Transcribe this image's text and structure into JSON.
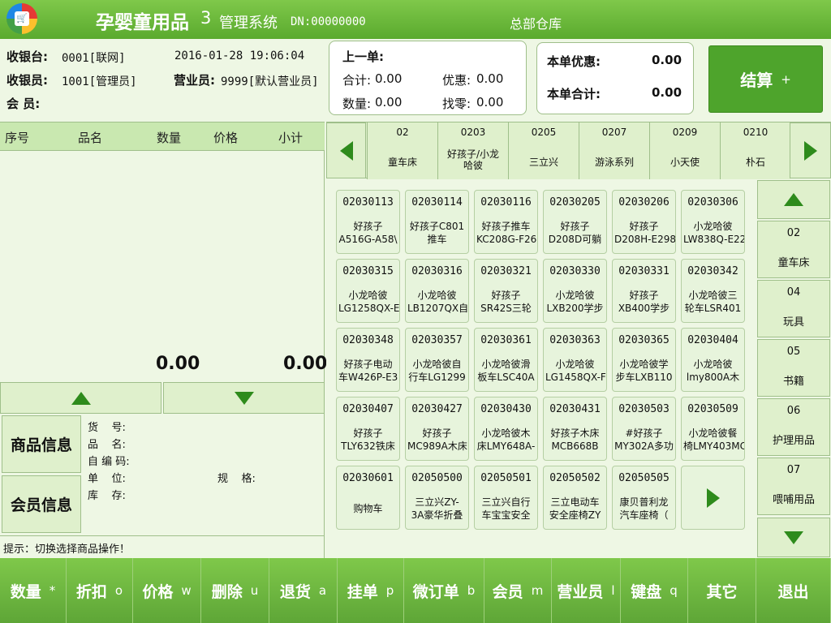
{
  "header": {
    "title": "孕婴童用品",
    "version": "3",
    "subtitle": "管理系统",
    "dn": "DN:00000000",
    "warehouse": "总部仓库"
  },
  "info": {
    "cashier_label": "收银台:",
    "cashier_value": "0001[联网]",
    "datetime": "2016-01-28 19:06:04",
    "operator_label": "收银员:",
    "operator_value": "1001[管理员]",
    "sales_label": "营业员:",
    "sales_value": "9999[默认营业员]",
    "member_label": "会  员:"
  },
  "last_order": {
    "title": "上一单:",
    "total_label": "合计:",
    "total": "0.00",
    "discount_label": "优惠:",
    "discount": "0.00",
    "qty_label": "数量:",
    "qty": "0.00",
    "change_label": "找零:",
    "change": "0.00"
  },
  "current": {
    "discount_label": "本单优惠:",
    "discount": "0.00",
    "total_label": "本单合计:",
    "total": "0.00"
  },
  "settle": {
    "label": "结算",
    "key": "+"
  },
  "list": {
    "headers": [
      "序号",
      "品名",
      "数量",
      "价格",
      "小计"
    ],
    "qty_total": "0.00",
    "sum_total": "0.00"
  },
  "info_panel": {
    "goods_tab": "商品信息",
    "member_tab": "会员信息",
    "fields": {
      "sku": "货    号:",
      "name": "品    名:",
      "code": "自 编 码:",
      "unit": "单    位:",
      "spec": "规    格:",
      "stock": "库    存:"
    }
  },
  "hint": "提示：切换选择商品操作！",
  "categories": [
    {
      "code": "02",
      "name": "童车床"
    },
    {
      "code": "0203",
      "name": "好孩子/小龙\n哈彼"
    },
    {
      "code": "0205",
      "name": "三立兴"
    },
    {
      "code": "0207",
      "name": "游泳系列"
    },
    {
      "code": "0209",
      "name": "小天使"
    },
    {
      "code": "0210",
      "name": "朴石"
    }
  ],
  "products": [
    {
      "code": "02030113",
      "name": "好孩子\nA516G-A58\\"
    },
    {
      "code": "02030114",
      "name": "好孩子C801\n推车"
    },
    {
      "code": "02030116",
      "name": "好孩子推车\nKC208G-F26"
    },
    {
      "code": "02030205",
      "name": "好孩子\nD208D可躺"
    },
    {
      "code": "02030206",
      "name": "好孩子\nD208H-E298"
    },
    {
      "code": "02030306",
      "name": "小龙哈彼\nLW838Q-E22"
    },
    {
      "code": "02030315",
      "name": "小龙哈彼\nLG1258QX-E"
    },
    {
      "code": "02030316",
      "name": "小龙哈彼\nLB1207QX自"
    },
    {
      "code": "02030321",
      "name": "好孩子\nSR42S三轮"
    },
    {
      "code": "02030330",
      "name": "小龙哈彼\nLXB200学步"
    },
    {
      "code": "02030331",
      "name": "好孩子\nXB400学步"
    },
    {
      "code": "02030342",
      "name": "小龙哈彼三\n轮车LSR401"
    },
    {
      "code": "02030348",
      "name": "好孩子电动\n车W426P-E3"
    },
    {
      "code": "02030357",
      "name": "小龙哈彼自\n行车LG1299"
    },
    {
      "code": "02030361",
      "name": "小龙哈彼滑\n板车LSC40A"
    },
    {
      "code": "02030363",
      "name": "小龙哈彼\nLG1458QX-F"
    },
    {
      "code": "02030365",
      "name": "小龙哈彼学\n步车LXB110"
    },
    {
      "code": "02030404",
      "name": "小龙哈彼\nlmy800A木"
    },
    {
      "code": "02030407",
      "name": "好孩子\nTLY632铁床"
    },
    {
      "code": "02030427",
      "name": "好孩子\nMC989A木床"
    },
    {
      "code": "02030430",
      "name": "小龙哈彼木\n床LMY648A-"
    },
    {
      "code": "02030431",
      "name": "好孩子木床\nMCB668B"
    },
    {
      "code": "02030503",
      "name": "#好孩子\nMY302A多功"
    },
    {
      "code": "02030509",
      "name": "小龙哈彼餐\n椅LMY403MC"
    },
    {
      "code": "02030601",
      "name": "购物车"
    },
    {
      "code": "02050500",
      "name": "三立兴ZY-\n3A豪华折叠"
    },
    {
      "code": "02050501",
      "name": "三立兴自行\n车宝宝安全"
    },
    {
      "code": "02050502",
      "name": "三立电动车\n安全座椅ZY"
    },
    {
      "code": "02050505",
      "name": "康贝普利龙\n汽车座椅（"
    }
  ],
  "side_categories": [
    {
      "code": "02",
      "name": "童车床"
    },
    {
      "code": "04",
      "name": "玩具"
    },
    {
      "code": "05",
      "name": "书籍"
    },
    {
      "code": "06",
      "name": "护理用品"
    },
    {
      "code": "07",
      "name": "喂哺用品"
    }
  ],
  "functions": [
    {
      "label": "数量",
      "key": "*"
    },
    {
      "label": "折扣",
      "key": "o"
    },
    {
      "label": "价格",
      "key": "w"
    },
    {
      "label": "删除",
      "key": "u"
    },
    {
      "label": "退货",
      "key": "a"
    },
    {
      "label": "挂单",
      "key": "p"
    },
    {
      "label": "微订单",
      "key": "b"
    },
    {
      "label": "会员",
      "key": "m"
    },
    {
      "label": "营业员",
      "key": "l"
    },
    {
      "label": "键盘",
      "key": "q"
    },
    {
      "label": "其它",
      "key": ""
    },
    {
      "label": "退出",
      "key": ""
    }
  ],
  "colors": {
    "accent": "#5aaa2e",
    "panel": "#dff0cc",
    "background": "#eef7e4"
  }
}
